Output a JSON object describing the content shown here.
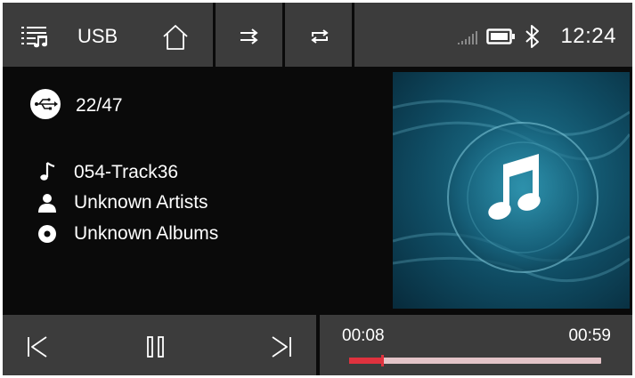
{
  "status_bar": {
    "source_label": "USB",
    "clock": "12:24",
    "signal_strength": 0
  },
  "toolbar": {
    "playlist_icon": "playlist-icon",
    "home_icon": "home-icon",
    "shuffle_icon": "shuffle-icon",
    "repeat_icon": "repeat-icon"
  },
  "now_playing": {
    "source_icon": "usb-icon",
    "track_position": "22/47",
    "title": "054-Track36",
    "artist": "Unknown Artists",
    "album": "Unknown Albums"
  },
  "playback": {
    "current_time": "00:08",
    "total_time": "00:59",
    "progress": 0.135
  },
  "colors": {
    "panel": "#3c3c3c",
    "background": "#0a0a0a",
    "progress_fill": "#e0323e",
    "progress_track": "#e4c4c8"
  }
}
